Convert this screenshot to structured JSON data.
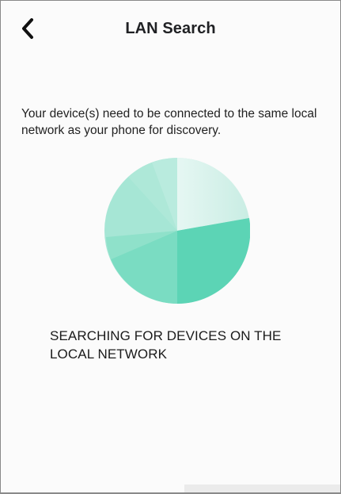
{
  "header": {
    "title": "LAN Search",
    "back_icon": "chevron-left-icon"
  },
  "instructions": {
    "text": "Your device(s) need to be connected to the same local network as your phone for discovery."
  },
  "radar": {
    "icon": "radar-sweep-icon",
    "colors": {
      "primary": "#5fd6b8",
      "light": "#9fe6d2",
      "faint": "#e6f7f3"
    }
  },
  "status": {
    "text": "SEARCHING FOR DEVICES ON THE LOCAL NETWORK"
  }
}
